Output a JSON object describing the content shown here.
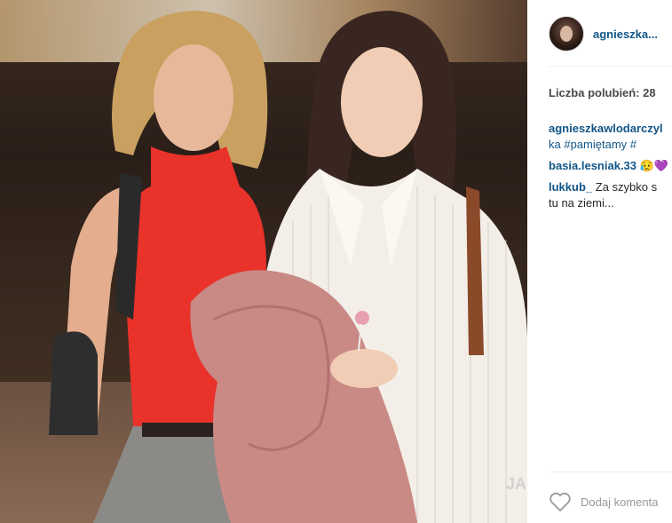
{
  "post": {
    "username": "agnieszka...",
    "likes_label": "Liczba polubień: 28",
    "comments": [
      {
        "user": "agnieszkawlodarczyk",
        "user_cont": "a",
        "text_prefix": "",
        "tags": "#pamiętamy #",
        "line1": "agnieszkawlodarczyl",
        "line2": "ka #pamiętamy #"
      },
      {
        "user": "basia.lesniak.33",
        "text": "😥💜"
      },
      {
        "user": "lukkub_",
        "text": "Za szybko s",
        "text_line2": "tu na ziemi..."
      }
    ],
    "add_comment_placeholder": "Dodaj komenta",
    "watermark": "JA"
  },
  "icons": {
    "like": "heart-outline-icon"
  },
  "colors": {
    "link": "#125688",
    "muted": "#999999"
  }
}
